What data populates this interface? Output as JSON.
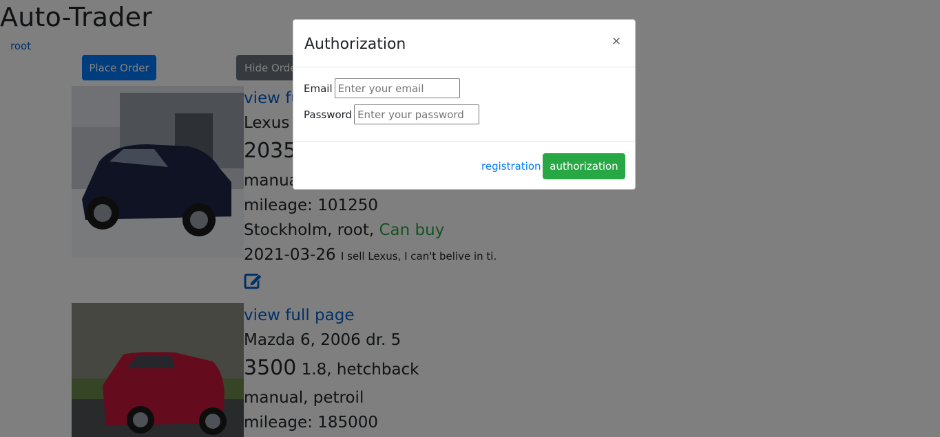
{
  "site": {
    "title": "Auto-Trader",
    "user": "root"
  },
  "toolbar": {
    "place_order": "Place Order",
    "hide_order": "Hide Order"
  },
  "cars": [
    {
      "link": "view full page",
      "name": "Lexus R",
      "price": "2035",
      "specs": "",
      "transmission": "manual, p",
      "mileage": "mileage: 101250",
      "city_user": "Stockholm, root,",
      "status": "Can buy",
      "date": "2021-03-26",
      "description": "I sell Lexus, I can't belive in ti."
    },
    {
      "link": "view full page",
      "name": "Mazda 6, 2006 dr. 5",
      "price": "3500",
      "specs": "1.8, hetchback",
      "transmission": "manual, petroil",
      "mileage": "mileage: 185000"
    }
  ],
  "modal": {
    "title": "Authorization",
    "close": "×",
    "email_label": "Email",
    "email_placeholder": "Enter your email",
    "password_label": "Password",
    "password_placeholder": "Enter your password",
    "registration": "registration",
    "authorization": "authorization"
  },
  "colors": {
    "primary": "#007bff",
    "secondary": "#6c757d",
    "success": "#28a745",
    "link": "#0062cc"
  }
}
